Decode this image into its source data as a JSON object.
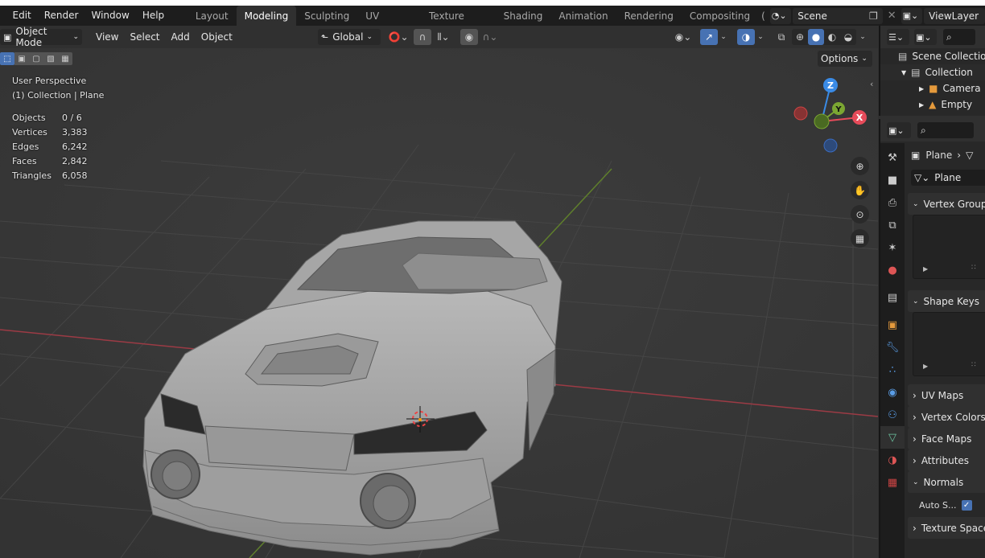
{
  "menubar": {
    "menus": [
      "Edit",
      "Render",
      "Window",
      "Help"
    ],
    "workspaces": [
      "Layout",
      "Modeling",
      "Sculpting",
      "UV Editing",
      "Texture Paint",
      "Shading",
      "Animation",
      "Rendering",
      "Compositing",
      "("
    ],
    "active_workspace": "Modeling",
    "scene": "Scene",
    "view_layer": "ViewLayer"
  },
  "viewport_header": {
    "mode": "Object Mode",
    "menus": [
      "View",
      "Select",
      "Add",
      "Object"
    ],
    "transform_orientation": "Global",
    "options_label": "Options"
  },
  "overlay": {
    "perspective": "User Perspective",
    "context": "(1) Collection | Plane",
    "stats": [
      {
        "label": "Objects",
        "value": "0 / 6"
      },
      {
        "label": "Vertices",
        "value": "3,383"
      },
      {
        "label": "Edges",
        "value": "6,242"
      },
      {
        "label": "Faces",
        "value": "2,842"
      },
      {
        "label": "Triangles",
        "value": "6,058"
      }
    ]
  },
  "gizmo": {
    "z": "Z",
    "y": "Y",
    "x": "X"
  },
  "outliner": {
    "root": "Scene Collection",
    "collection": "Collection",
    "items": [
      "Camera",
      "Empty"
    ]
  },
  "properties": {
    "object_name": "Plane",
    "data_name": "Plane",
    "panels": {
      "vertex_groups": "Vertex Groups",
      "shape_keys": "Shape Keys",
      "uv_maps": "UV Maps",
      "vertex_colors": "Vertex Colors",
      "face_maps": "Face Maps",
      "attributes": "Attributes",
      "normals": "Normals",
      "auto_smooth": "Auto S...",
      "texture_space": "Texture Space"
    }
  },
  "colors": {
    "accent": "#4772b3",
    "x_axis": "#e64b5a",
    "y_axis": "#7ba632",
    "z_axis": "#3a8be6"
  }
}
